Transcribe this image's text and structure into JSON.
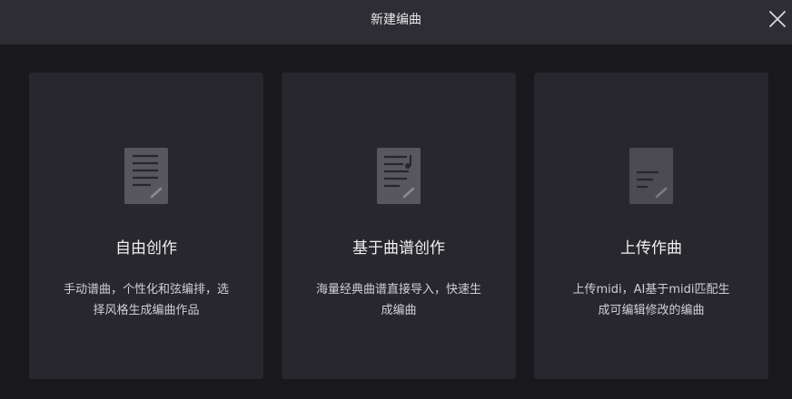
{
  "dialog": {
    "title": "新建编曲",
    "close_icon": "close-icon"
  },
  "options": [
    {
      "icon": "document-lines-icon",
      "title": "自由创作",
      "desc": "手动谱曲，个性化和弦编排，选择风格生成编曲作品"
    },
    {
      "icon": "sheet-music-icon",
      "title": "基于曲谱创作",
      "desc": "海量经典曲谱直接导入，快速生成编曲"
    },
    {
      "icon": "upload-document-icon",
      "title": "上传作曲",
      "desc": "上传midi，AI基于midi匹配生成可编辑修改的编曲"
    }
  ],
  "colors": {
    "background": "#18181d",
    "titlebar": "#2d2d33",
    "card": "#27272d",
    "icon_paper": "#57575d",
    "icon_lines": "#26262b"
  }
}
